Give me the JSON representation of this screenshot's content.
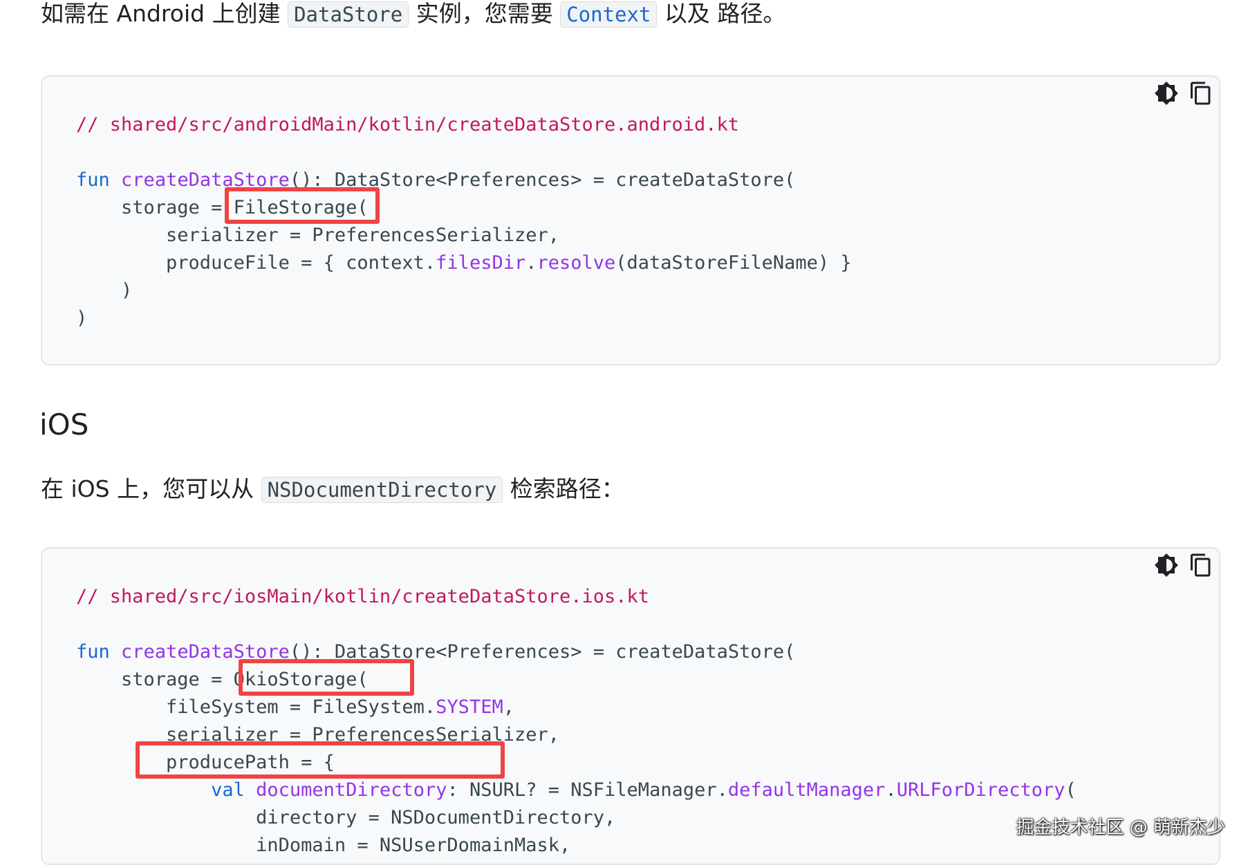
{
  "android_para": {
    "t1": "如需在 Android 上创建 ",
    "code1": "DataStore",
    "t2": " 实例，您需要 ",
    "code2": "Context",
    "t3": " 以及 路径。"
  },
  "android_code": {
    "comment": "// shared/src/androidMain/kotlin/createDataStore.android.kt",
    "l1_kw": "fun",
    "l1_fn": "createDataStore",
    "l1_rest": "(): DataStore<Preferences> = createDataStore(",
    "l2": "    storage = FileStorage(",
    "l3": "        serializer = PreferencesSerializer,",
    "l4_a": "        produceFile = { context.",
    "l4_fn1": "filesDir",
    "l4_dot": ".",
    "l4_fn2": "resolve",
    "l4_b": "(dataStoreFileName) }",
    "l5": "    )",
    "l6": ")"
  },
  "ios_heading": "iOS",
  "ios_para": {
    "t1": "在 iOS 上，您可以从 ",
    "code1": "NSDocumentDirectory",
    "t2": " 检索路径："
  },
  "ios_code": {
    "comment": "// shared/src/iosMain/kotlin/createDataStore.ios.kt",
    "l1_kw": "fun",
    "l1_fn": "createDataStore",
    "l1_rest": "(): DataStore<Preferences> = createDataStore(",
    "l2": "    storage = OkioStorage(",
    "l3_a": "        fileSystem = FileSystem.",
    "l3_fn": "SYSTEM",
    "l3_b": ",",
    "l4": "        serializer = PreferencesSerializer,",
    "l5": "        producePath = {",
    "l6_indent": "            ",
    "l6_kw": "val",
    "l6_fn": "documentDirectory",
    "l6_a": ": NSURL? = NSFileManager.",
    "l6_fn2": "defaultManager",
    "l6_dot": ".",
    "l6_fn3": "URLForDirectory",
    "l6_b": "(",
    "l7": "                directory = NSDocumentDirectory,",
    "l8": "                inDomain = NSUserDomainMask,"
  },
  "toolbar": {
    "theme_icon": "brightness-icon",
    "copy_icon": "copy-icon"
  },
  "colors": {
    "comment": "#c2185b",
    "keyword": "#1967d2",
    "function": "#9334e6",
    "highlight": "#ef4444"
  },
  "watermark": "掘金技术社区 @ 萌新杰少"
}
